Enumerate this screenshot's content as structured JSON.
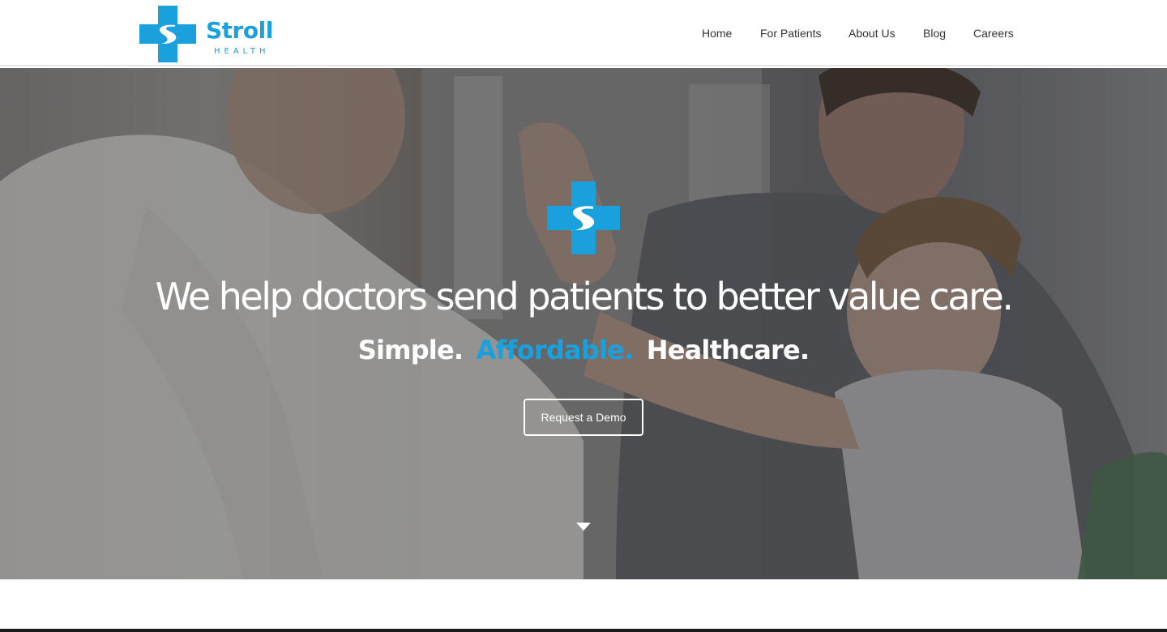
{
  "brand": {
    "name": "Stroll",
    "subname": "HEALTH",
    "logo_icon": "medical-cross-s-icon",
    "primary_color": "#1aa0dc",
    "wordmark_color": "#1aa0dc"
  },
  "nav": {
    "items": [
      {
        "label": "Home"
      },
      {
        "label": "For Patients"
      },
      {
        "label": "About Us"
      },
      {
        "label": "Blog"
      },
      {
        "label": "Careers"
      }
    ],
    "text_color": "#333333"
  },
  "hero": {
    "headline": "We help doctors send patients to better value care.",
    "tagline": {
      "part1": "Simple.",
      "part2": "Affordable.",
      "part3": "Healthcare."
    },
    "tagline_accent_color": "#1aa0dc",
    "text_color": "#ffffff",
    "cta_label": "Request a Demo",
    "background_image": "doctor-high-five-child-photo",
    "scroll_icon": "caret-down-icon"
  }
}
